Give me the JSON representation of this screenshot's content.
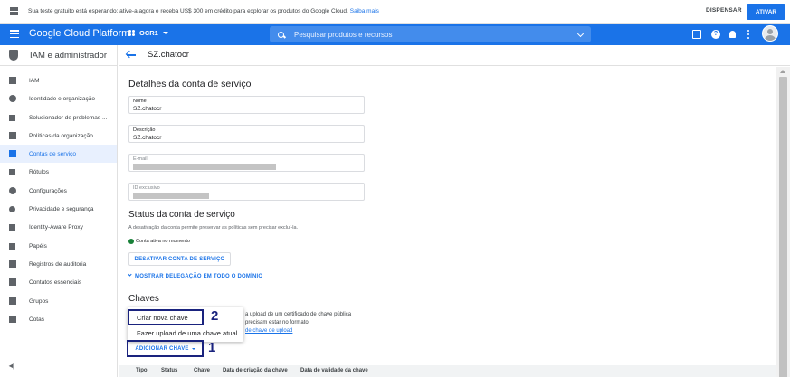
{
  "banner": {
    "text": "Sua teste gratuito está esperando: ative-a agora e receba US$ 300 em crédito para explorar os produtos do Google Cloud.",
    "link": "Saiba mais",
    "dismiss": "DISPENSAR",
    "activate": "ATIVAR"
  },
  "appbar": {
    "title": "Google Cloud Platform",
    "project": "OCR1",
    "search_placeholder": "Pesquisar produtos e recursos",
    "help_glyph": "?"
  },
  "sidebar": {
    "title": "IAM e administrador",
    "collapse_glyph": "◂|",
    "items": [
      {
        "label": "IAM",
        "icon": "person-add-icon"
      },
      {
        "label": "Identidade e organização",
        "icon": "account-circle-icon"
      },
      {
        "label": "Solucionador de problemas ...",
        "icon": "wrench-icon"
      },
      {
        "label": "Políticas da organização",
        "icon": "list-icon"
      },
      {
        "label": "Contas de serviço",
        "icon": "service-account-icon",
        "active": true
      },
      {
        "label": "Rótulos",
        "icon": "tag-icon"
      },
      {
        "label": "Configurações",
        "icon": "gear-icon"
      },
      {
        "label": "Privacidade e segurança",
        "icon": "shield-icon"
      },
      {
        "label": "Identity-Aware Proxy",
        "icon": "proxy-icon"
      },
      {
        "label": "Papéis",
        "icon": "roles-icon"
      },
      {
        "label": "Registros de auditoria",
        "icon": "audit-list-icon"
      },
      {
        "label": "Contatos essenciais",
        "icon": "contacts-icon"
      },
      {
        "label": "Grupos",
        "icon": "groups-icon"
      },
      {
        "label": "Cotas",
        "icon": "quota-icon"
      }
    ]
  },
  "main": {
    "page_title": "SZ.chatocr",
    "details_heading": "Detalhes da conta de serviço",
    "fields": {
      "name_label": "Nome",
      "name_value": "SZ.chatocr",
      "description_label": "Descrição",
      "description_value": "SZ.chatocr",
      "email_label": "E-mail",
      "id_label": "ID exclusivo"
    },
    "status_heading": "Status da conta de serviço",
    "status_hint": "A desativação da conta permite preservar as políticas sem precisar excluí-la.",
    "status_ok": "Conta ativa no momento",
    "disable_button": "DESATIVAR CONTA DE SERVIÇO",
    "expand_link": "MOSTRAR DELEGAÇÃO EM TODO O DOMÍNIO",
    "keys_heading": "Chaves",
    "keys_text_1": "a upload de um certificado de chave pública",
    "keys_text_2": "precisam estar no formato",
    "keys_link": "de chave de upload",
    "menu": {
      "create_key": "Criar nova chave",
      "upload_key": "Fazer upload de uma chave atual"
    },
    "add_key_button": "ADICIONAR CHAVE",
    "callouts": [
      "1",
      "2"
    ],
    "table_headers": [
      "Tipo",
      "Status",
      "Chave",
      "Data de criação da chave",
      "Data de validade da chave"
    ]
  },
  "colors": {
    "brand_blue": "#1a73e8",
    "callout_navy": "#1a237e",
    "active_green": "#188038"
  }
}
